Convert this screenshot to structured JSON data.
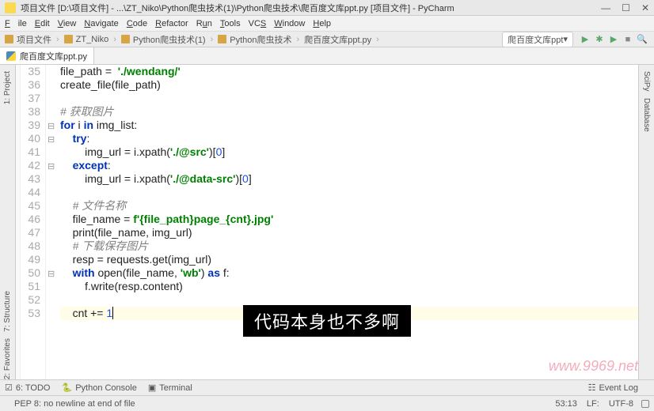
{
  "window": {
    "title": "项目文件 [D:\\项目文件] - ...\\ZT_Niko\\Python爬虫技术(1)\\Python爬虫技术\\爬百度文库ppt.py [项目文件] - PyCharm",
    "controls": {
      "min": "—",
      "max": "☐",
      "close": "✕"
    }
  },
  "menu": {
    "file": "File",
    "edit": "Edit",
    "view": "View",
    "navigate": "Navigate",
    "code": "Code",
    "refactor": "Refactor",
    "run": "Run",
    "tools": "Tools",
    "vcs": "VCS",
    "window": "Window",
    "help": "Help"
  },
  "breadcrumbs": [
    "项目文件",
    "ZT_Niko",
    "Python爬虫技术(1)",
    "Python爬虫技术",
    "爬百度文库ppt.py"
  ],
  "run_config": "爬百度文库ppt",
  "open_tab": "爬百度文库ppt.py",
  "left_tools": {
    "project": "1: Project",
    "structure": "7: Structure",
    "favorites": "2: Favorites"
  },
  "right_tools": {
    "scipy": "SciPy",
    "database": "Database"
  },
  "bottom_tabs": {
    "todo": "6: TODO",
    "console": "Python Console",
    "terminal": "Terminal",
    "event_log": "Event Log"
  },
  "status": {
    "left": "PEP 8: no newline at end of file",
    "pos": "53:13",
    "sep": "LF:",
    "enc": "UTF-8"
  },
  "gutter_start": 35,
  "code_lines": [
    {
      "t": "file_path =  './wendang/'",
      "seg": [
        [
          "",
          "file_path =  "
        ],
        [
          "str",
          "'./wendang/'"
        ]
      ],
      "indent": 0
    },
    {
      "t": "create_file(file_path)",
      "seg": [
        [
          "",
          "create_file(file_path)"
        ]
      ],
      "indent": 0
    },
    {
      "t": "",
      "seg": [],
      "indent": 0
    },
    {
      "t": "# 获取图片",
      "seg": [
        [
          "cmt",
          "# 获取图片"
        ]
      ],
      "indent": 0
    },
    {
      "t": "for i in img_list:",
      "seg": [
        [
          "kw",
          "for"
        ],
        [
          "",
          " i "
        ],
        [
          "kw",
          "in"
        ],
        [
          "",
          " img_list:"
        ]
      ],
      "indent": 0,
      "fold": "-"
    },
    {
      "t": "try:",
      "seg": [
        [
          "kw",
          "try"
        ],
        [
          "",
          ":"
        ]
      ],
      "indent": 1,
      "fold": "-"
    },
    {
      "t": "img_url = i.xpath('./@src')[0]",
      "seg": [
        [
          "",
          "img_url = i.xpath("
        ],
        [
          "str",
          "'./@src'"
        ],
        [
          "",
          ")["
        ],
        [
          "num",
          "0"
        ],
        [
          "",
          "]"
        ]
      ],
      "indent": 2
    },
    {
      "t": "except:",
      "seg": [
        [
          "kw",
          "except"
        ],
        [
          "",
          ":"
        ]
      ],
      "indent": 1,
      "fold": "-"
    },
    {
      "t": "img_url = i.xpath('./@data-src')[0]",
      "seg": [
        [
          "",
          "img_url = i.xpath("
        ],
        [
          "str",
          "'./@data-src'"
        ],
        [
          "",
          ")["
        ],
        [
          "num",
          "0"
        ],
        [
          "",
          "]"
        ]
      ],
      "indent": 2
    },
    {
      "t": "",
      "seg": [],
      "indent": 0
    },
    {
      "t": "# 文件名称",
      "seg": [
        [
          "cmt",
          "# 文件名称"
        ]
      ],
      "indent": 1
    },
    {
      "t": "file_name = f'{file_path}page_{cnt}.jpg'",
      "seg": [
        [
          "",
          "file_name = "
        ],
        [
          "str",
          "f'"
        ],
        [
          "fstr",
          "{file_path}"
        ],
        [
          "str",
          "page_"
        ],
        [
          "fstr",
          "{cnt}"
        ],
        [
          "str",
          ".jpg'"
        ]
      ],
      "indent": 1
    },
    {
      "t": "print(file_name, img_url)",
      "seg": [
        [
          "",
          "print(file_name, img_url)"
        ]
      ],
      "indent": 1
    },
    {
      "t": "# 下载保存图片",
      "seg": [
        [
          "cmt",
          "# 下载保存图片"
        ]
      ],
      "indent": 1
    },
    {
      "t": "resp = requests.get(img_url)",
      "seg": [
        [
          "",
          "resp = requests.get(img_url)"
        ]
      ],
      "indent": 1
    },
    {
      "t": "with open(file_name, 'wb') as f:",
      "seg": [
        [
          "kw",
          "with"
        ],
        [
          "",
          " open(file_name, "
        ],
        [
          "str",
          "'wb'"
        ],
        [
          "",
          ") "
        ],
        [
          "kw",
          "as"
        ],
        [
          "",
          " f:"
        ]
      ],
      "indent": 1,
      "fold": "-"
    },
    {
      "t": "f.write(resp.content)",
      "seg": [
        [
          "",
          "f.write(resp.content)"
        ]
      ],
      "indent": 2
    },
    {
      "t": "",
      "seg": [],
      "indent": 0
    },
    {
      "t": "cnt += 1",
      "seg": [
        [
          "",
          "cnt += "
        ],
        [
          "num",
          "1"
        ]
      ],
      "indent": 1,
      "hl": true,
      "caret": true
    }
  ],
  "caption": "代码本身也不多啊",
  "watermark": "www.9969.net"
}
